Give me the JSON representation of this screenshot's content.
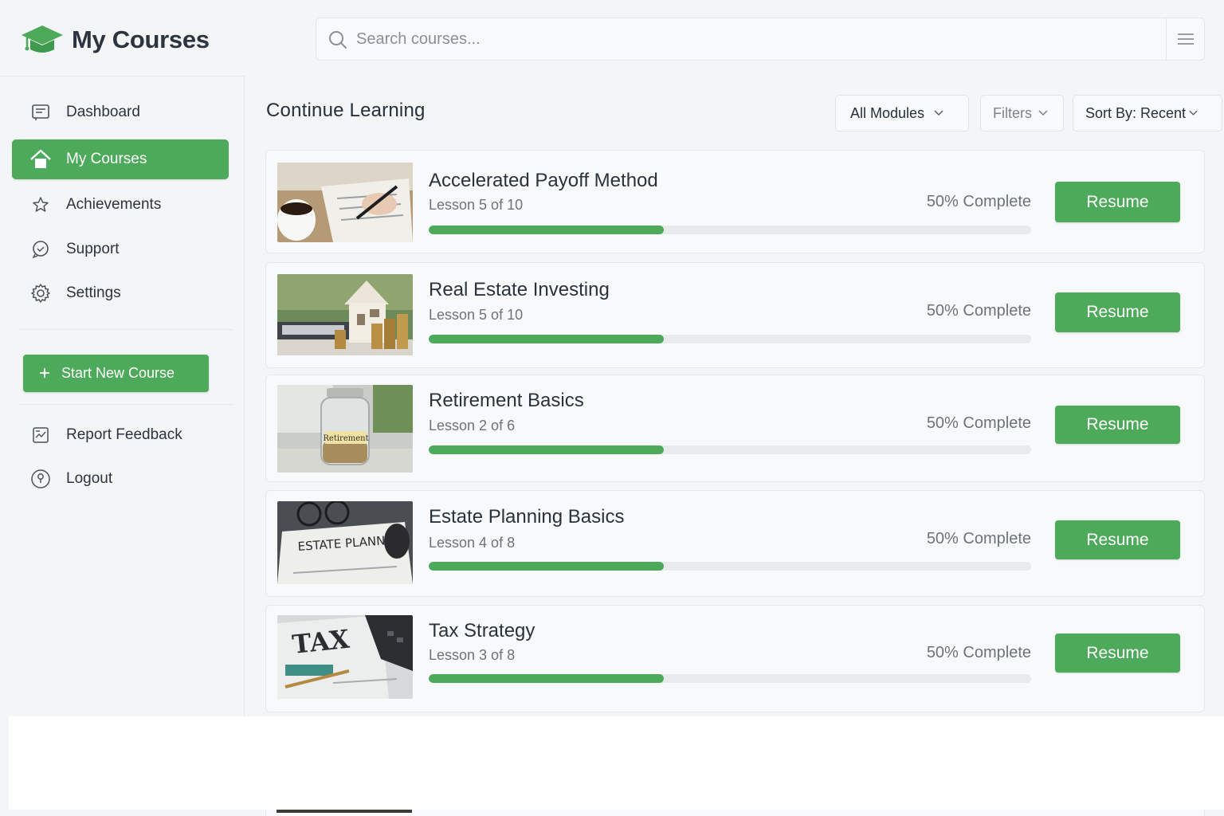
{
  "app": {
    "title": "My Courses"
  },
  "search": {
    "placeholder": "Search courses..."
  },
  "sidebar": {
    "items": [
      {
        "label": "Dashboard",
        "icon": "dashboard-icon",
        "active": false
      },
      {
        "label": "My Courses",
        "icon": "home-icon",
        "active": true
      },
      {
        "label": "Achievements",
        "icon": "star-icon",
        "active": false
      },
      {
        "label": "Support",
        "icon": "chat-icon",
        "active": false
      },
      {
        "label": "Settings",
        "icon": "gear-icon",
        "active": false
      }
    ],
    "start_button": "Start New Course",
    "secondary": [
      {
        "label": "Report Feedback",
        "icon": "feedback-icon"
      },
      {
        "label": "Logout",
        "icon": "logout-icon"
      }
    ]
  },
  "main": {
    "section_title": "Continue Learning",
    "filters": {
      "modules": "All Modules",
      "filters": "Filters",
      "sort": "Sort By: Recent"
    },
    "courses": [
      {
        "title": "Accelerated Payoff Method",
        "lesson": "Lesson 5 of 10",
        "progress_text": "50% Complete",
        "progress": 0.5,
        "button": "Resume",
        "thumb": "coffee-paperwork"
      },
      {
        "title": "Real Estate Investing",
        "lesson": "Lesson 5 of 10",
        "progress_text": "50% Complete",
        "progress": 0.5,
        "button": "Resume",
        "thumb": "house-coins"
      },
      {
        "title": "Retirement Basics",
        "lesson": "Lesson 2 of 6",
        "progress_text": "50% Complete",
        "progress": 0.5,
        "button": "Resume",
        "thumb": "retirement-jar",
        "thumb_text": "Retirement"
      },
      {
        "title": "Estate Planning Basics",
        "lesson": "Lesson 4 of 8",
        "progress_text": "50% Complete",
        "progress": 0.5,
        "button": "Resume",
        "thumb": "estate-planning-doc",
        "thumb_text": "ESTATE PLANNING"
      },
      {
        "title": "Tax Strategy",
        "lesson": "Lesson 3 of 8",
        "progress_text": "50% Complete",
        "progress": 0.5,
        "button": "Resume",
        "thumb": "tax-calculator",
        "thumb_text": "TAX"
      }
    ]
  },
  "colors": {
    "accent": "#4caa5a",
    "background": "#f4f5f6",
    "card": "#f8f9fa"
  }
}
